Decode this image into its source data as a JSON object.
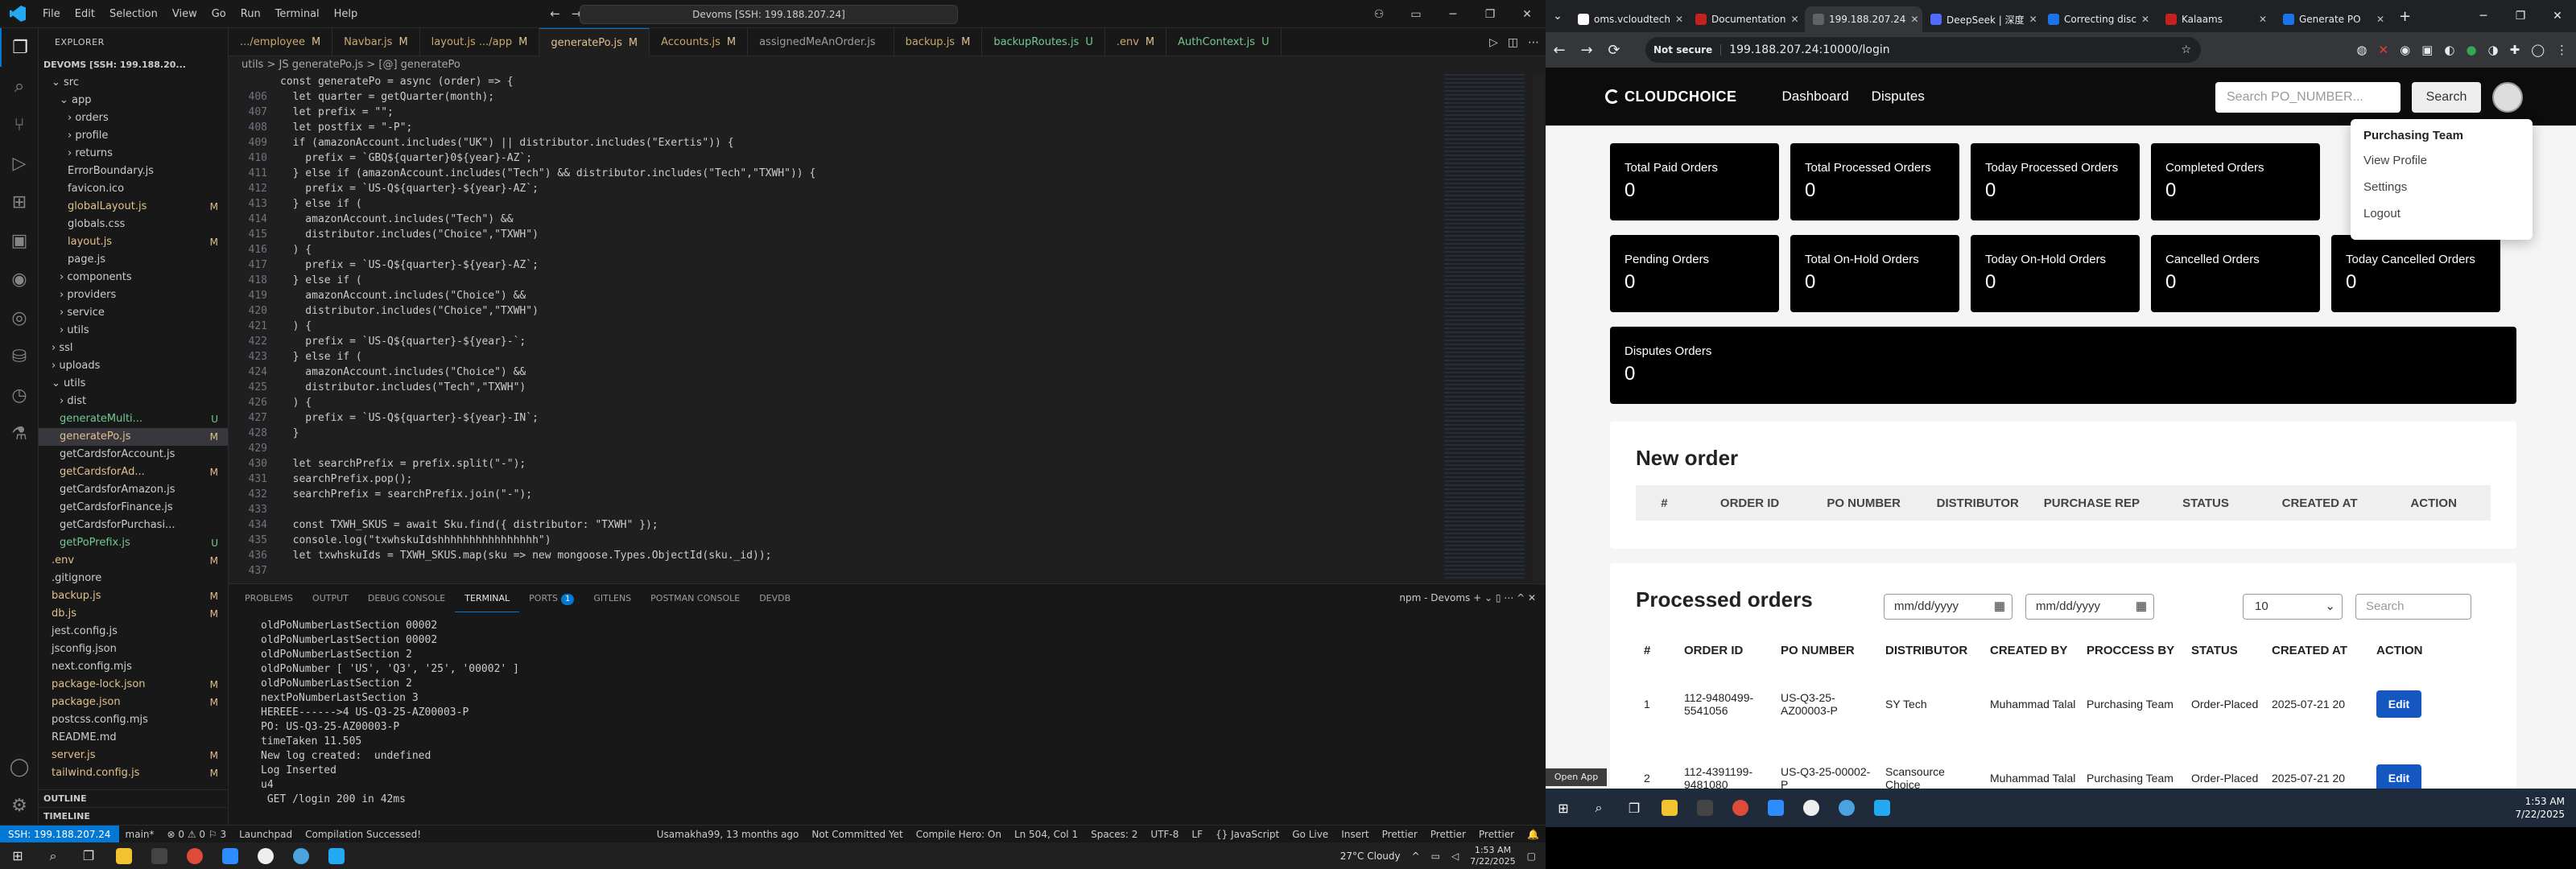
{
  "vscode": {
    "menu": [
      "File",
      "Edit",
      "Selection",
      "View",
      "Go",
      "Run",
      "Terminal",
      "Help"
    ],
    "search": "Devoms [SSH: 199.188.207.24]",
    "explorer_title": "EXPLORER",
    "root": "DEVOMS [SSH: 199.188.20...",
    "tree": [
      {
        "label": "src",
        "indent": 1,
        "status": "",
        "chev": "v"
      },
      {
        "label": "app",
        "indent": 2,
        "status": "",
        "chev": "v"
      },
      {
        "label": "orders",
        "indent": 3,
        "status": "",
        "chev": ">"
      },
      {
        "label": "profile",
        "indent": 3,
        "status": "",
        "chev": ">"
      },
      {
        "label": "returns",
        "indent": 3,
        "status": "",
        "chev": ">"
      },
      {
        "label": "ErrorBoundary.js",
        "indent": 3,
        "status": "",
        "chev": ""
      },
      {
        "label": "favicon.ico",
        "indent": 3,
        "status": "",
        "chev": ""
      },
      {
        "label": "globalLayout.js",
        "indent": 3,
        "status": "M",
        "chev": ""
      },
      {
        "label": "globals.css",
        "indent": 3,
        "status": "",
        "chev": ""
      },
      {
        "label": "layout.js",
        "indent": 3,
        "status": "M",
        "chev": ""
      },
      {
        "label": "page.js",
        "indent": 3,
        "status": "",
        "chev": ""
      },
      {
        "label": "components",
        "indent": 2,
        "status": "",
        "chev": ">"
      },
      {
        "label": "providers",
        "indent": 2,
        "status": "",
        "chev": ">"
      },
      {
        "label": "service",
        "indent": 2,
        "status": "",
        "chev": ">"
      },
      {
        "label": "utils",
        "indent": 2,
        "status": "",
        "chev": ">"
      },
      {
        "label": "ssl",
        "indent": 1,
        "status": "",
        "chev": ">"
      },
      {
        "label": "uploads",
        "indent": 1,
        "status": "",
        "chev": ">"
      },
      {
        "label": "utils",
        "indent": 1,
        "status": "",
        "chev": "v"
      },
      {
        "label": "dist",
        "indent": 2,
        "status": "",
        "chev": ">"
      },
      {
        "label": "generateMulti...",
        "indent": 2,
        "status": "U",
        "chev": ""
      },
      {
        "label": "generatePo.js",
        "indent": 2,
        "status": "M",
        "chev": "",
        "sel": true
      },
      {
        "label": "getCardsforAccount.js",
        "indent": 2,
        "status": "",
        "chev": ""
      },
      {
        "label": "getCardsforAd...",
        "indent": 2,
        "status": "M",
        "chev": ""
      },
      {
        "label": "getCardsforAmazon.js",
        "indent": 2,
        "status": "",
        "chev": ""
      },
      {
        "label": "getCardsforFinance.js",
        "indent": 2,
        "status": "",
        "chev": ""
      },
      {
        "label": "getCardsforPurchasi...",
        "indent": 2,
        "status": "",
        "chev": ""
      },
      {
        "label": "getPoPrefix.js",
        "indent": 2,
        "status": "U",
        "chev": ""
      },
      {
        "label": ".env",
        "indent": 1,
        "status": "M",
        "chev": ""
      },
      {
        "label": ".gitignore",
        "indent": 1,
        "status": "",
        "chev": ""
      },
      {
        "label": "backup.js",
        "indent": 1,
        "status": "M",
        "chev": ""
      },
      {
        "label": "db.js",
        "indent": 1,
        "status": "M",
        "chev": ""
      },
      {
        "label": "jest.config.js",
        "indent": 1,
        "status": "",
        "chev": ""
      },
      {
        "label": "jsconfig.json",
        "indent": 1,
        "status": "",
        "chev": ""
      },
      {
        "label": "next.config.mjs",
        "indent": 1,
        "status": "",
        "chev": ""
      },
      {
        "label": "package-lock.json",
        "indent": 1,
        "status": "M",
        "chev": ""
      },
      {
        "label": "package.json",
        "indent": 1,
        "status": "M",
        "chev": ""
      },
      {
        "label": "postcss.config.mjs",
        "indent": 1,
        "status": "",
        "chev": ""
      },
      {
        "label": "README.md",
        "indent": 1,
        "status": "",
        "chev": ""
      },
      {
        "label": "server.js",
        "indent": 1,
        "status": "M",
        "chev": ""
      },
      {
        "label": "tailwind.config.js",
        "indent": 1,
        "status": "M",
        "chev": ""
      }
    ],
    "outline": "OUTLINE",
    "timeline": "TIMELINE",
    "tabs": [
      {
        "label": ".../employee",
        "status": "M"
      },
      {
        "label": "Navbar.js",
        "status": "M"
      },
      {
        "label": "layout.js .../app",
        "status": "M"
      },
      {
        "label": "generatePo.js",
        "status": "M",
        "active": true
      },
      {
        "label": "Accounts.js",
        "status": "M"
      },
      {
        "label": "assignedMeAnOrder.js",
        "status": ""
      },
      {
        "label": "backup.js",
        "status": "M"
      },
      {
        "label": "backupRoutes.js",
        "status": "U"
      },
      {
        "label": ".env",
        "status": "M"
      },
      {
        "label": "AuthContext.js",
        "status": "U"
      }
    ],
    "breadcrumb": "utils > JS generatePo.js > [@] generatePo",
    "code": [
      {
        "n": "",
        "t": "const generatePo = async (order) => {"
      },
      {
        "n": "406",
        "t": "  let quarter = getQuarter(month);"
      },
      {
        "n": "407",
        "t": "  let prefix = \"\";"
      },
      {
        "n": "408",
        "t": "  let postfix = \"-P\";"
      },
      {
        "n": "409",
        "t": "  if (amazonAccount.includes(\"UK\") || distributor.includes(\"Exertis\")) {"
      },
      {
        "n": "410",
        "t": "    prefix = `GBQ${quarter}0${year}-AZ`;"
      },
      {
        "n": "411",
        "t": "  } else if (amazonAccount.includes(\"Tech\") && distributor.includes(\"Tech\",\"TXWH\")) {"
      },
      {
        "n": "412",
        "t": "    prefix = `US-Q${quarter}-${year}-AZ`;"
      },
      {
        "n": "413",
        "t": "  } else if ("
      },
      {
        "n": "414",
        "t": "    amazonAccount.includes(\"Tech\") &&"
      },
      {
        "n": "415",
        "t": "    distributor.includes(\"Choice\",\"TXWH\")"
      },
      {
        "n": "416",
        "t": "  ) {"
      },
      {
        "n": "417",
        "t": "    prefix = `US-Q${quarter}-${year}-AZ`;"
      },
      {
        "n": "418",
        "t": "  } else if ("
      },
      {
        "n": "419",
        "t": "    amazonAccount.includes(\"Choice\") &&"
      },
      {
        "n": "420",
        "t": "    distributor.includes(\"Choice\",\"TXWH\")"
      },
      {
        "n": "421",
        "t": "  ) {"
      },
      {
        "n": "422",
        "t": "    prefix = `US-Q${quarter}-${year}-`;"
      },
      {
        "n": "423",
        "t": "  } else if ("
      },
      {
        "n": "424",
        "t": "    amazonAccount.includes(\"Choice\") &&"
      },
      {
        "n": "425",
        "t": "    distributor.includes(\"Tech\",\"TXWH\")"
      },
      {
        "n": "426",
        "t": "  ) {"
      },
      {
        "n": "427",
        "t": "    prefix = `US-Q${quarter}-${year}-IN`;"
      },
      {
        "n": "428",
        "t": "  }"
      },
      {
        "n": "429",
        "t": ""
      },
      {
        "n": "430",
        "t": "  let searchPrefix = prefix.split(\"-\");"
      },
      {
        "n": "431",
        "t": "  searchPrefix.pop();"
      },
      {
        "n": "432",
        "t": "  searchPrefix = searchPrefix.join(\"-\");"
      },
      {
        "n": "433",
        "t": ""
      },
      {
        "n": "434",
        "t": "  const TXWH_SKUS = await Sku.find({ distributor: \"TXWH\" });"
      },
      {
        "n": "435",
        "t": "  console.log(\"txwhskuIdshhhhhhhhhhhhhhhh\")"
      },
      {
        "n": "436",
        "t": "  let txwhskuIds = TXWH_SKUS.map(sku => new mongoose.Types.ObjectId(sku._id));"
      },
      {
        "n": "437",
        "t": ""
      }
    ],
    "panel_tabs": [
      "PROBLEMS",
      "OUTPUT",
      "DEBUG CONSOLE",
      "TERMINAL",
      "PORTS",
      "GITLENS",
      "POSTMAN CONSOLE",
      "DEVDB"
    ],
    "ports_badge": "1",
    "panel_right": "npm - Devoms  +  ⌄  ▯  ⋯  ^  ✕",
    "terminal": [
      "oldPoNumberLastSection 00002",
      "oldPoNumberLastSection 00002",
      "oldPoNumberLastSection 2",
      "oldPoNumber [ 'US', 'Q3', '25', '00002' ]",
      "oldPoNumberLastSection 2",
      "nextPoNumberLastSection 3",
      "HEREEE------>4 US-Q3-25-AZ00003-P",
      "PO: US-Q3-25-AZ00003-P",
      "timeTaken 11.505",
      "New log created:  undefined",
      "Log Inserted",
      "u4",
      " GET /login 200 in 42ms",
      ""
    ],
    "status": {
      "remote": "SSH: 199.188.207.24",
      "branch": "main*",
      "errors": "⊗ 0 ⚠ 0 ⚐ 3",
      "launch": "Launchpad",
      "compile": "Compilation Successed!",
      "blame": "Usamakha99, 13 months ago",
      "commit": "Not Committed Yet",
      "hero": "Compile Hero: On",
      "pos": "Ln 504, Col 1",
      "spaces": "Spaces: 2",
      "enc": "UTF-8",
      "eol": "LF",
      "lang": "{} JavaScript",
      "golive": "Go Live",
      "insert": "Insert",
      "prettier1": "Prettier",
      "prettier2": "Prettier",
      "prettier3": "Prettier"
    },
    "taskbar": {
      "weather": "27°C Cloudy",
      "time": "1:53 AM",
      "date": "7/22/2025"
    }
  },
  "chrome": {
    "tabs": [
      {
        "label": "oms.vcloudtech",
        "color": "#ffffff"
      },
      {
        "label": "Documentation",
        "color": "#c5221f"
      },
      {
        "label": "199.188.207.24",
        "color": "#5f6368",
        "active": true
      },
      {
        "label": "DeepSeek | 深度",
        "color": "#4d6bfe"
      },
      {
        "label": "Correcting disc",
        "color": "#1a73e8"
      },
      {
        "label": "Kalaams",
        "color": "#c5221f"
      },
      {
        "label": "Generate PO",
        "color": "#1a73e8"
      }
    ],
    "address_ns": "Not secure",
    "address": "199.188.207.24:10000/login",
    "site": {
      "logo": "CLOUDCHOICE",
      "nav": [
        "Dashboard",
        "Disputes"
      ],
      "search_placeholder": "Search PO_NUMBER...",
      "search_btn": "Search",
      "cards_row1": [
        {
          "label": "Total Paid Orders",
          "value": "0"
        },
        {
          "label": "Total Processed Orders",
          "value": "0"
        },
        {
          "label": "Today Processed Orders",
          "value": "0"
        },
        {
          "label": "Completed Orders",
          "value": "0"
        }
      ],
      "cards_row2": [
        {
          "label": "Pending Orders",
          "value": "0"
        },
        {
          "label": "Total On-Hold Orders",
          "value": "0"
        },
        {
          "label": "Today On-Hold Orders",
          "value": "0"
        },
        {
          "label": "Cancelled Orders",
          "value": "0"
        },
        {
          "label": "Today Cancelled Orders",
          "value": "0"
        }
      ],
      "disputes": {
        "label": "Disputes Orders",
        "value": "0"
      },
      "dropdown": {
        "header": "Purchasing Team",
        "items": [
          "View Profile",
          "Settings",
          "Logout"
        ]
      },
      "new_order": {
        "title": "New order",
        "columns": [
          "#",
          "ORDER ID",
          "PO NUMBER",
          "DISTRIBUTOR",
          "PURCHASE REP",
          "STATUS",
          "CREATED AT",
          "ACTION"
        ]
      },
      "processed": {
        "title": "Processed orders",
        "date_placeholder": "mm/dd/yyyy",
        "page_size": "10",
        "search_placeholder": "Search",
        "columns": [
          "#",
          "ORDER ID",
          "PO NUMBER",
          "DISTRIBUTOR",
          "CREATED BY",
          "PROCCESS BY",
          "STATUS",
          "CREATED AT",
          "ACTION"
        ],
        "rows": [
          {
            "n": "1",
            "order": "112-9480499-5541056",
            "po": "US-Q3-25-AZ00003-P",
            "dist": "SY Tech",
            "by": "Muhammad Talal",
            "proc": "Purchasing Team",
            "status": "Order-Placed",
            "at": "2025-07-21 20",
            "action": "Edit"
          },
          {
            "n": "2",
            "order": "112-4391199-9481080",
            "po": "US-Q3-25-00002-P",
            "dist": "Scansource Choice",
            "by": "Muhammad Talal",
            "proc": "Purchasing Team",
            "status": "Order-Placed",
            "at": "2025-07-21 20",
            "action": "Edit"
          }
        ]
      }
    },
    "open_app": "Open App",
    "taskbar": {
      "time": "1:53 AM",
      "date": "7/22/2025"
    }
  }
}
